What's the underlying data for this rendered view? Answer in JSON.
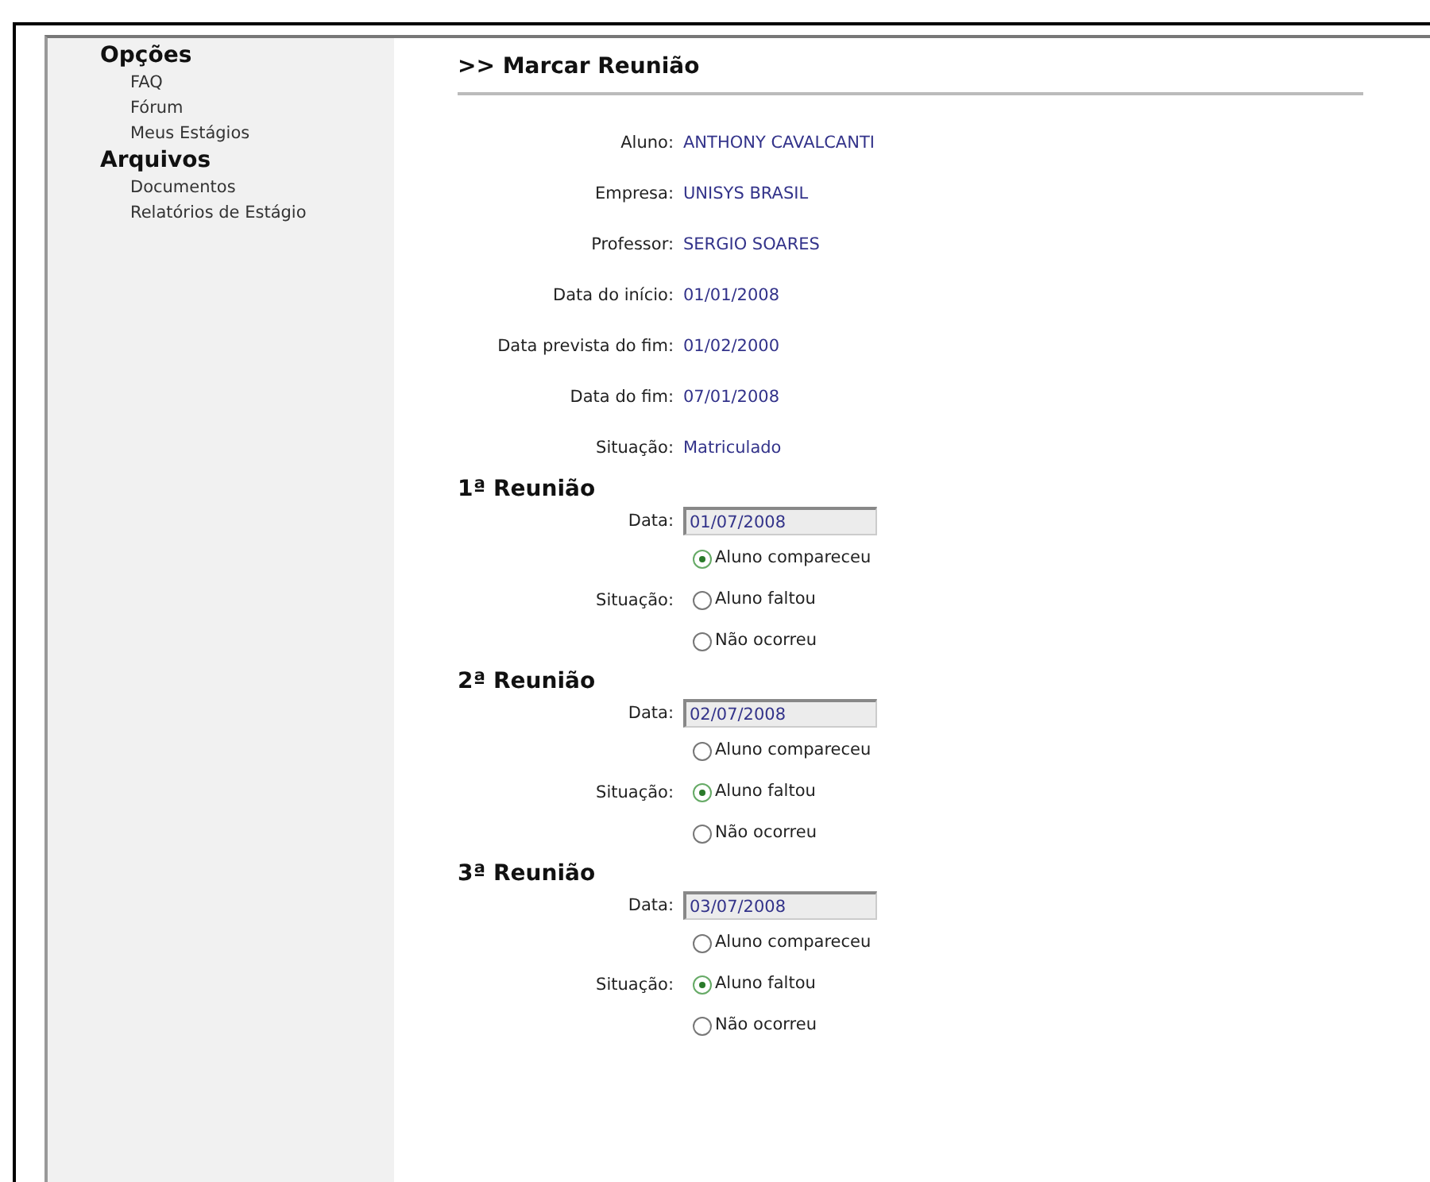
{
  "sidebar": {
    "sections": [
      {
        "title": "Opções",
        "items": [
          "FAQ",
          "Fórum",
          "Meus Estágios"
        ]
      },
      {
        "title": "Arquivos",
        "items": [
          "Documentos",
          "Relatórios de Estágio"
        ]
      }
    ]
  },
  "page_title": ">> Marcar Reunião",
  "info": [
    {
      "label": "Aluno:",
      "value": "ANTHONY CAVALCANTI"
    },
    {
      "label": "Empresa:",
      "value": "UNISYS BRASIL"
    },
    {
      "label": "Professor:",
      "value": "SERGIO SOARES"
    },
    {
      "label": "Data do início:",
      "value": "01/01/2008"
    },
    {
      "label": "Data prevista do fim:",
      "value": "01/02/2000"
    },
    {
      "label": "Data do fim:",
      "value": "07/01/2008"
    },
    {
      "label": "Situação:",
      "value": "Matriculado"
    }
  ],
  "meetings": [
    {
      "title": "1ª Reunião",
      "date_label": "Data:",
      "date": "01/07/2008",
      "status_label": "Situação:",
      "options": [
        {
          "label": "Aluno compareceu",
          "selected": true
        },
        {
          "label": "Aluno faltou",
          "selected": false
        },
        {
          "label": "Não ocorreu",
          "selected": false
        }
      ]
    },
    {
      "title": "2ª Reunião",
      "date_label": "Data:",
      "date": "02/07/2008",
      "status_label": "Situação:",
      "options": [
        {
          "label": "Aluno compareceu",
          "selected": false
        },
        {
          "label": "Aluno faltou",
          "selected": true
        },
        {
          "label": "Não ocorreu",
          "selected": false
        }
      ]
    },
    {
      "title": "3ª Reunião",
      "date_label": "Data:",
      "date": "03/07/2008",
      "status_label": "Situação:",
      "options": [
        {
          "label": "Aluno compareceu",
          "selected": false
        },
        {
          "label": "Aluno faltou",
          "selected": true
        },
        {
          "label": "Não ocorreu",
          "selected": false
        }
      ]
    }
  ]
}
